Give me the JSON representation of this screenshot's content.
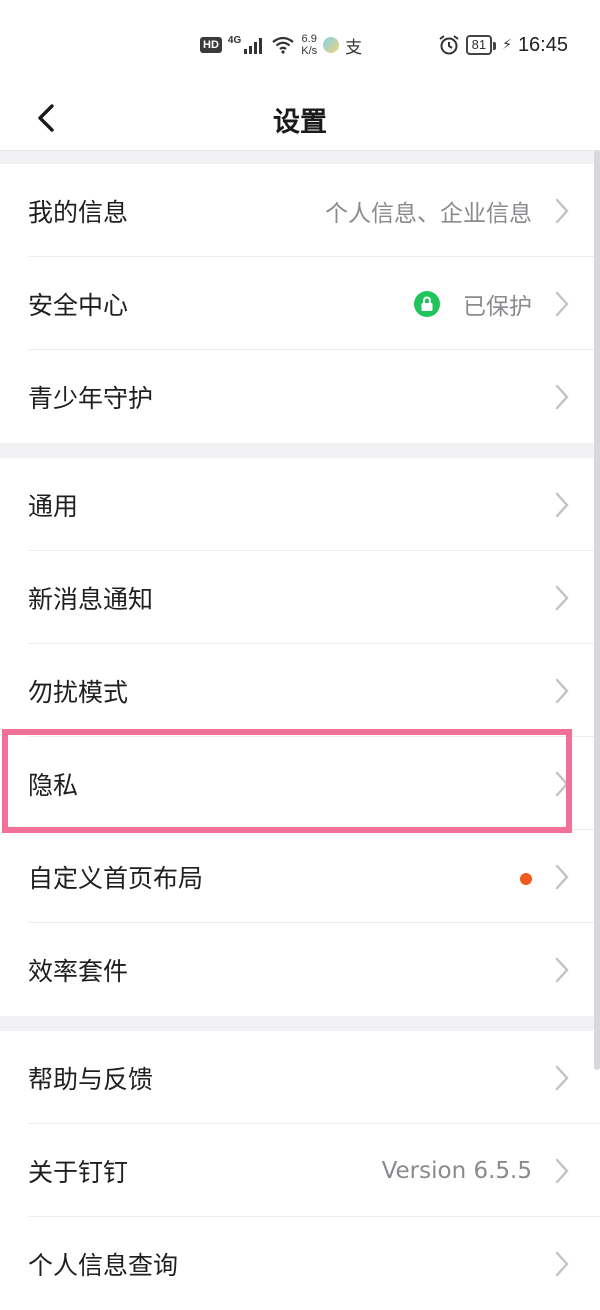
{
  "status_bar": {
    "hd": "HD",
    "network": "4G",
    "speed_value": "6.9",
    "speed_unit": "K/s",
    "zhi_glyph": "支",
    "battery": "81",
    "time": "16:45",
    "icons": [
      "signal-icon",
      "wifi-icon",
      "alarm-icon",
      "charging-icon"
    ]
  },
  "header": {
    "title": "设置",
    "back_icon": "chevron-left-icon"
  },
  "section1": [
    {
      "label": "我的信息",
      "value": "个人信息、企业信息"
    },
    {
      "label": "安全中心",
      "value": "已保护",
      "badge_icon": "lock-icon",
      "badge_color": "#1fc45d"
    },
    {
      "label": "青少年守护",
      "value": ""
    }
  ],
  "section2": [
    {
      "label": "通用"
    },
    {
      "label": "新消息通知"
    },
    {
      "label": "勿扰模式"
    },
    {
      "label": "隐私",
      "highlighted": true,
      "highlight_color": "#f07098"
    },
    {
      "label": "自定义首页布局",
      "dot_color": "#f25a1d"
    },
    {
      "label": "效率套件"
    }
  ],
  "section3": [
    {
      "label": "帮助与反馈"
    },
    {
      "label": "关于钉钉",
      "value": "Version 6.5.5"
    },
    {
      "label": "个人信息查询"
    }
  ]
}
